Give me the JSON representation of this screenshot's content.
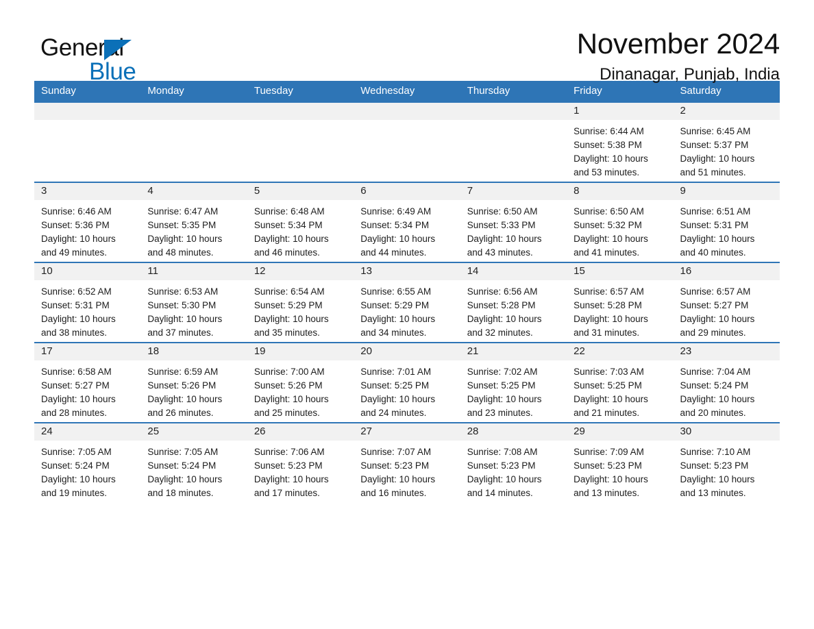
{
  "brand": {
    "word_one": "General",
    "word_two": "Blue",
    "accent_color": "#0b70b8",
    "triangle_icon": "triangle-icon"
  },
  "header": {
    "month_title": "November 2024",
    "location": "Dinanagar, Punjab, India"
  },
  "calendar": {
    "header_color": "#2e75b6",
    "daynum_strip_color": "#f1f1f1",
    "weekdays": [
      "Sunday",
      "Monday",
      "Tuesday",
      "Wednesday",
      "Thursday",
      "Friday",
      "Saturday"
    ],
    "weeks": [
      [
        {
          "day": "",
          "empty": true
        },
        {
          "day": "",
          "empty": true
        },
        {
          "day": "",
          "empty": true
        },
        {
          "day": "",
          "empty": true
        },
        {
          "day": "",
          "empty": true
        },
        {
          "day": "1",
          "sunrise": "Sunrise: 6:44 AM",
          "sunset": "Sunset: 5:38 PM",
          "daylight1": "Daylight: 10 hours",
          "daylight2": "and 53 minutes."
        },
        {
          "day": "2",
          "sunrise": "Sunrise: 6:45 AM",
          "sunset": "Sunset: 5:37 PM",
          "daylight1": "Daylight: 10 hours",
          "daylight2": "and 51 minutes."
        }
      ],
      [
        {
          "day": "3",
          "sunrise": "Sunrise: 6:46 AM",
          "sunset": "Sunset: 5:36 PM",
          "daylight1": "Daylight: 10 hours",
          "daylight2": "and 49 minutes."
        },
        {
          "day": "4",
          "sunrise": "Sunrise: 6:47 AM",
          "sunset": "Sunset: 5:35 PM",
          "daylight1": "Daylight: 10 hours",
          "daylight2": "and 48 minutes."
        },
        {
          "day": "5",
          "sunrise": "Sunrise: 6:48 AM",
          "sunset": "Sunset: 5:34 PM",
          "daylight1": "Daylight: 10 hours",
          "daylight2": "and 46 minutes."
        },
        {
          "day": "6",
          "sunrise": "Sunrise: 6:49 AM",
          "sunset": "Sunset: 5:34 PM",
          "daylight1": "Daylight: 10 hours",
          "daylight2": "and 44 minutes."
        },
        {
          "day": "7",
          "sunrise": "Sunrise: 6:50 AM",
          "sunset": "Sunset: 5:33 PM",
          "daylight1": "Daylight: 10 hours",
          "daylight2": "and 43 minutes."
        },
        {
          "day": "8",
          "sunrise": "Sunrise: 6:50 AM",
          "sunset": "Sunset: 5:32 PM",
          "daylight1": "Daylight: 10 hours",
          "daylight2": "and 41 minutes."
        },
        {
          "day": "9",
          "sunrise": "Sunrise: 6:51 AM",
          "sunset": "Sunset: 5:31 PM",
          "daylight1": "Daylight: 10 hours",
          "daylight2": "and 40 minutes."
        }
      ],
      [
        {
          "day": "10",
          "sunrise": "Sunrise: 6:52 AM",
          "sunset": "Sunset: 5:31 PM",
          "daylight1": "Daylight: 10 hours",
          "daylight2": "and 38 minutes."
        },
        {
          "day": "11",
          "sunrise": "Sunrise: 6:53 AM",
          "sunset": "Sunset: 5:30 PM",
          "daylight1": "Daylight: 10 hours",
          "daylight2": "and 37 minutes."
        },
        {
          "day": "12",
          "sunrise": "Sunrise: 6:54 AM",
          "sunset": "Sunset: 5:29 PM",
          "daylight1": "Daylight: 10 hours",
          "daylight2": "and 35 minutes."
        },
        {
          "day": "13",
          "sunrise": "Sunrise: 6:55 AM",
          "sunset": "Sunset: 5:29 PM",
          "daylight1": "Daylight: 10 hours",
          "daylight2": "and 34 minutes."
        },
        {
          "day": "14",
          "sunrise": "Sunrise: 6:56 AM",
          "sunset": "Sunset: 5:28 PM",
          "daylight1": "Daylight: 10 hours",
          "daylight2": "and 32 minutes."
        },
        {
          "day": "15",
          "sunrise": "Sunrise: 6:57 AM",
          "sunset": "Sunset: 5:28 PM",
          "daylight1": "Daylight: 10 hours",
          "daylight2": "and 31 minutes."
        },
        {
          "day": "16",
          "sunrise": "Sunrise: 6:57 AM",
          "sunset": "Sunset: 5:27 PM",
          "daylight1": "Daylight: 10 hours",
          "daylight2": "and 29 minutes."
        }
      ],
      [
        {
          "day": "17",
          "sunrise": "Sunrise: 6:58 AM",
          "sunset": "Sunset: 5:27 PM",
          "daylight1": "Daylight: 10 hours",
          "daylight2": "and 28 minutes."
        },
        {
          "day": "18",
          "sunrise": "Sunrise: 6:59 AM",
          "sunset": "Sunset: 5:26 PM",
          "daylight1": "Daylight: 10 hours",
          "daylight2": "and 26 minutes."
        },
        {
          "day": "19",
          "sunrise": "Sunrise: 7:00 AM",
          "sunset": "Sunset: 5:26 PM",
          "daylight1": "Daylight: 10 hours",
          "daylight2": "and 25 minutes."
        },
        {
          "day": "20",
          "sunrise": "Sunrise: 7:01 AM",
          "sunset": "Sunset: 5:25 PM",
          "daylight1": "Daylight: 10 hours",
          "daylight2": "and 24 minutes."
        },
        {
          "day": "21",
          "sunrise": "Sunrise: 7:02 AM",
          "sunset": "Sunset: 5:25 PM",
          "daylight1": "Daylight: 10 hours",
          "daylight2": "and 23 minutes."
        },
        {
          "day": "22",
          "sunrise": "Sunrise: 7:03 AM",
          "sunset": "Sunset: 5:25 PM",
          "daylight1": "Daylight: 10 hours",
          "daylight2": "and 21 minutes."
        },
        {
          "day": "23",
          "sunrise": "Sunrise: 7:04 AM",
          "sunset": "Sunset: 5:24 PM",
          "daylight1": "Daylight: 10 hours",
          "daylight2": "and 20 minutes."
        }
      ],
      [
        {
          "day": "24",
          "sunrise": "Sunrise: 7:05 AM",
          "sunset": "Sunset: 5:24 PM",
          "daylight1": "Daylight: 10 hours",
          "daylight2": "and 19 minutes."
        },
        {
          "day": "25",
          "sunrise": "Sunrise: 7:05 AM",
          "sunset": "Sunset: 5:24 PM",
          "daylight1": "Daylight: 10 hours",
          "daylight2": "and 18 minutes."
        },
        {
          "day": "26",
          "sunrise": "Sunrise: 7:06 AM",
          "sunset": "Sunset: 5:23 PM",
          "daylight1": "Daylight: 10 hours",
          "daylight2": "and 17 minutes."
        },
        {
          "day": "27",
          "sunrise": "Sunrise: 7:07 AM",
          "sunset": "Sunset: 5:23 PM",
          "daylight1": "Daylight: 10 hours",
          "daylight2": "and 16 minutes."
        },
        {
          "day": "28",
          "sunrise": "Sunrise: 7:08 AM",
          "sunset": "Sunset: 5:23 PM",
          "daylight1": "Daylight: 10 hours",
          "daylight2": "and 14 minutes."
        },
        {
          "day": "29",
          "sunrise": "Sunrise: 7:09 AM",
          "sunset": "Sunset: 5:23 PM",
          "daylight1": "Daylight: 10 hours",
          "daylight2": "and 13 minutes."
        },
        {
          "day": "30",
          "sunrise": "Sunrise: 7:10 AM",
          "sunset": "Sunset: 5:23 PM",
          "daylight1": "Daylight: 10 hours",
          "daylight2": "and 13 minutes."
        }
      ]
    ]
  }
}
